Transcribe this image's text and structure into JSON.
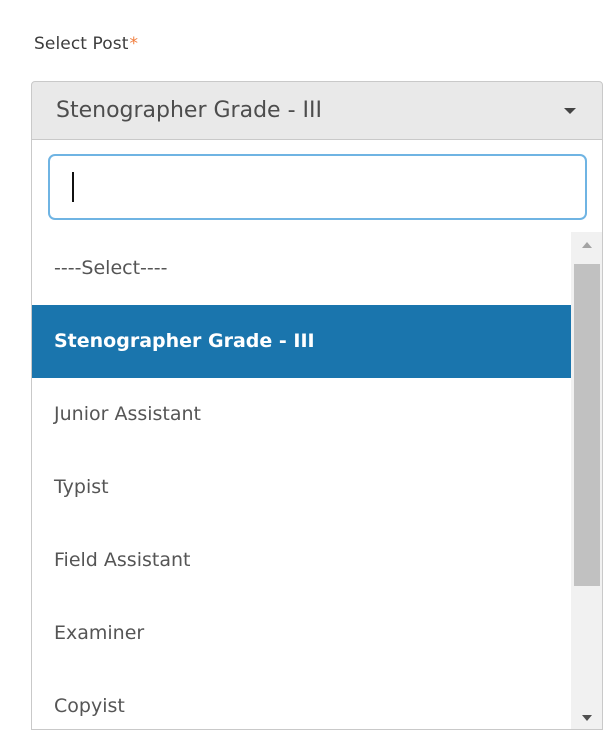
{
  "field": {
    "label": "Select Post",
    "required_marker": "*",
    "selected_value": "Stenographer Grade - III"
  },
  "dropdown": {
    "search_value": "",
    "options": [
      {
        "label": "----Select----",
        "selected": false
      },
      {
        "label": "Stenographer Grade - III",
        "selected": true
      },
      {
        "label": "Junior Assistant",
        "selected": false
      },
      {
        "label": "Typist",
        "selected": false
      },
      {
        "label": "Field Assistant",
        "selected": false
      },
      {
        "label": "Examiner",
        "selected": false
      },
      {
        "label": "Copyist",
        "selected": false
      }
    ]
  },
  "icons": {
    "caret": "chevron-down-icon",
    "scroll_up": "scroll-up-arrow-icon",
    "scroll_down": "scroll-down-arrow-icon"
  },
  "colors": {
    "selected_bg": "#1a75ad",
    "selected_text": "#ffffff",
    "required_marker": "#f07c3c",
    "search_focus_border": "#6fb4e3",
    "select_box_bg": "#e9e9e9"
  }
}
